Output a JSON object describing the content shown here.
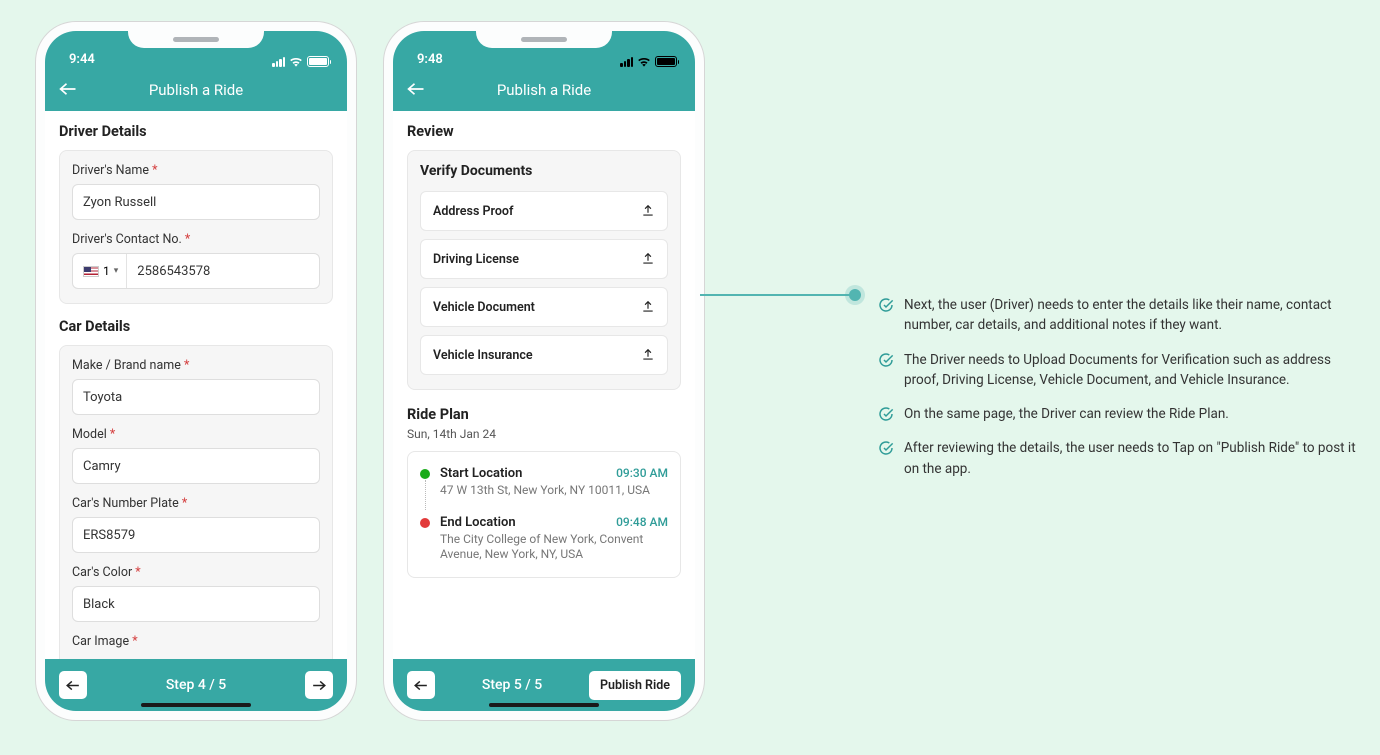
{
  "colors": {
    "teal": "#37a8a4"
  },
  "phone1": {
    "time": "9:44",
    "title": "Publish a Ride",
    "driverDetailsTitle": "Driver Details",
    "driverNameLabel": "Driver's Name",
    "driverNameValue": "Zyon Russell",
    "driverContactLabel": "Driver's Contact No.",
    "countryCode": "1",
    "phoneValue": "2586543578",
    "carDetailsTitle": "Car Details",
    "makeLabel": "Make / Brand name",
    "makeValue": "Toyota",
    "modelLabel": "Model",
    "modelValue": "Camry",
    "plateLabel": "Car's Number Plate",
    "plateValue": "ERS8579",
    "colorLabel": "Car's Color",
    "colorValue": "Black",
    "carImageLabel": "Car Image",
    "stepText": "Step 4 / 5"
  },
  "phone2": {
    "time": "9:48",
    "title": "Publish a Ride",
    "reviewTitle": "Review",
    "verifyTitle": "Verify Documents",
    "docs": {
      "0": "Address Proof",
      "1": "Driving License",
      "2": "Vehicle Document",
      "3": "Vehicle Insurance"
    },
    "ridePlanTitle": "Ride Plan",
    "ridePlanDate": "Sun, 14th Jan 24",
    "start": {
      "label": "Start Location",
      "time": "09:30 AM",
      "addr": "47 W 13th St, New York, NY 10011, USA"
    },
    "end": {
      "label": "End Location",
      "time": "09:48 AM",
      "addr": "The City College of New York, Convent Avenue, New York, NY, USA"
    },
    "stepText": "Step 5 / 5",
    "publishLabel": "Publish Ride"
  },
  "notes": {
    "0": "Next, the user (Driver) needs to enter the details like their name, contact number, car details, and additional notes if they want.",
    "1": "The Driver needs to Upload Documents for Verification such as address proof, Driving License, Vehicle Document, and Vehicle Insurance.",
    "2": "On the same page, the Driver can review the Ride Plan.",
    "3": "After reviewing the details, the user needs to Tap on \"Publish Ride\" to post it on the app."
  }
}
